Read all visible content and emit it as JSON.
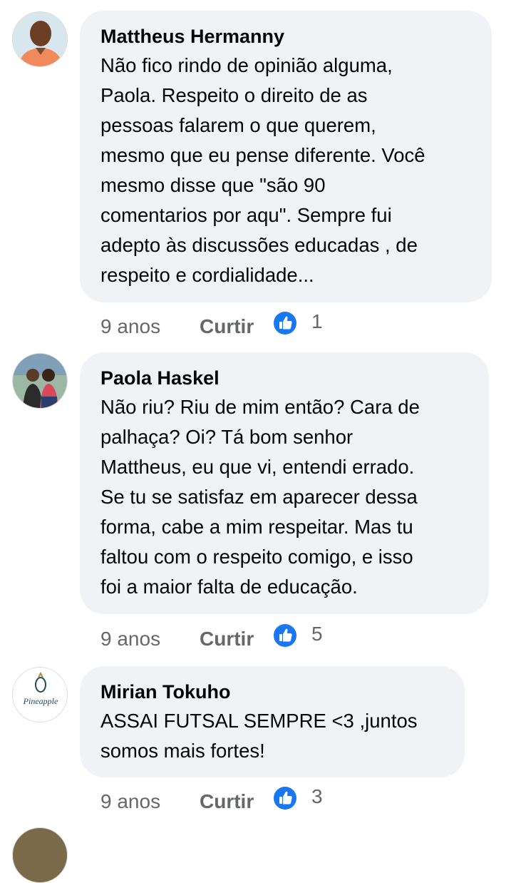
{
  "comments": [
    {
      "author": "Mattheus Hermanny",
      "text": "Não fico rindo de opinião alguma,\nPaola. Respeito o direito de as\npessoas falarem o que querem,\nmesmo que eu pense diferente. Você\nmesmo disse que \"são 90\ncomentarios por aqu\".  Sempre fui\nadepto às discussões educadas , de\nrespeito e cordialidade...",
      "time": "9 anos",
      "like_label": "Curtir",
      "reaction_count": "1"
    },
    {
      "author": "Paola Haskel",
      "text": "Não riu? Riu de mim então?  Cara de\npalhaça? Oi? Tá bom senhor\nMattheus, eu que vi, entendi errado.\nSe tu se satisfaz em aparecer dessa\nforma, cabe a mim respeitar. Mas tu\nfaltou com o respeito comigo, e isso\nfoi a maior falta de educação.",
      "time": "9 anos",
      "like_label": "Curtir",
      "reaction_count": "5"
    },
    {
      "author": "Mirian Tokuho",
      "avatar_logo_text": "Pineapple",
      "text": "ASSAI FUTSAL SEMPRE <3 ,juntos\nsomos mais fortes!",
      "time": "9 anos",
      "like_label": "Curtir",
      "reaction_count": "3"
    }
  ],
  "colors": {
    "bubble": "#f0f2f5",
    "like_blue": "#1877f2",
    "meta_gray": "#65676b"
  },
  "icons": {
    "reaction": "thumbs-up-icon"
  }
}
